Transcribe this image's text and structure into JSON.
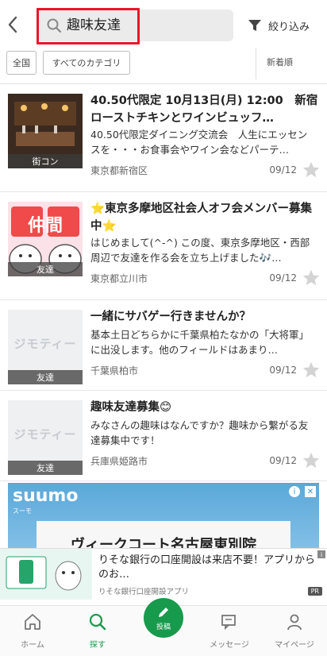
{
  "header": {
    "search_value": "趣味友達",
    "filter_label": "絞り込み"
  },
  "categories": {
    "area_label": "全国",
    "category_label": "すべてのカテゴリ",
    "sort_label": "新着順"
  },
  "items": [
    {
      "title": "40.50代限定 10月13日(月) 12:00　新宿　ローストチキンとワインビュッフ…",
      "description": "40.50代限定ダイニング交流会　人生にエッセンスを・・・お食事会やワイン会などパーテ…",
      "location": "東京都新宿区",
      "date": "09/12",
      "badge": "街コン"
    },
    {
      "title": "⭐東京多摩地区社会人オフ会メンバー募集中⭐",
      "description": "はじめまして(^-^) この度、東京多摩地区・西部周辺で友達を作る会を立ち上げました🎶…",
      "location": "東京都立川市",
      "date": "09/12",
      "badge": "友達",
      "image_text": "仲間"
    },
    {
      "title": "一緒にサバゲー行きませんか？",
      "description": "基本土日どちらかに千葉県柏たなかの「大将軍」に出没します。他のフィールドはあまり…",
      "location": "千葉県柏市",
      "date": "09/12",
      "badge": "友達",
      "placeholder_text": "ジモティー"
    },
    {
      "title": "趣味友達募集😊",
      "description": "みなさんの趣味はなんですか？趣味から繋がる友達募集中です！",
      "location": "兵庫県姫路市",
      "date": "09/12",
      "badge": "友達",
      "placeholder_text": "ジモティー"
    }
  ],
  "ad": {
    "brand": "suumo",
    "brand_sub": "スーモ",
    "headline": "ヴィークコート名古屋東別院"
  },
  "banner": {
    "title": "りそな銀行の口座開設は来店不要！アプリからのお…",
    "subtitle": "りそな銀行口座開設アプリ",
    "pr": "PR"
  },
  "tabs": [
    {
      "label": "ホーム"
    },
    {
      "label": "探す"
    },
    {
      "label": "投稿"
    },
    {
      "label": "メッセージ"
    },
    {
      "label": "マイページ"
    }
  ],
  "colors": {
    "accent": "#179a4c",
    "highlight": "#e8162a"
  }
}
